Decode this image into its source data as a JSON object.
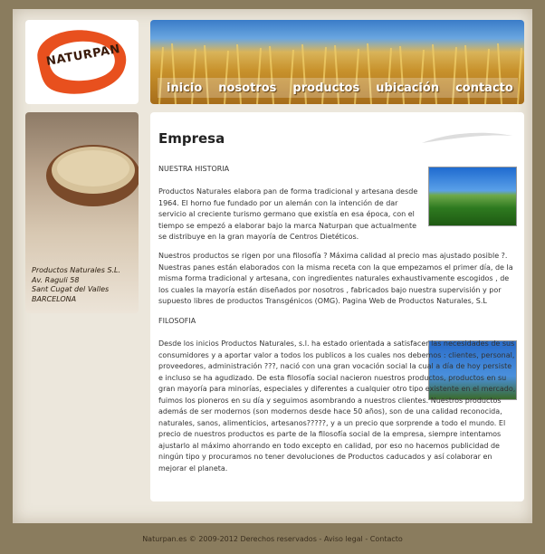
{
  "logo": {
    "text": "NATURPAN"
  },
  "nav": {
    "items": [
      "inicio",
      "nosotros",
      "productos",
      "ubicación",
      "contacto"
    ]
  },
  "sidebar": {
    "address": [
      "Productos Naturales S.L.",
      "Av. Raguli 58",
      "Sant Cugat del Valles",
      "BARCELONA"
    ]
  },
  "content": {
    "title": "Empresa",
    "section1_title": "NUESTRA HISTORIA",
    "section1_p1": "Productos Naturales elabora pan de forma tradicional y artesana desde 1964. El horno fue fundado por un alemán con la intención de dar servicio al creciente turismo germano que existía en esa época, con el tiempo se empezó a elaborar bajo la marca Naturpan que actualmente se distribuye en la gran mayoría de Centros Dietéticos.",
    "section1_p2": "Nuestros productos se rigen por una filosofía ? Máxima calidad al precio mas ajustado posible ?. Nuestras panes están elaborados con la misma receta con la que empezamos el primer día, de la misma forma tradicional y artesana, con ingredientes naturales exhaustivamente escogidos , de los cuales la mayoría están diseñados por nosotros , fabricados bajo nuestra supervisión y por supuesto libres de productos Transgénicos (OMG). Pagina Web de Productos Naturales, S.L",
    "section2_title": "FILOSOFIA",
    "section2_p1": "Desde los inicios Productos Naturales, s.l. ha estado orientada a satisfacer las necesidades de sus consumidores y a aportar valor a todos los publicos a los cuales nos debemos : clientes, personal, proveedores, administración ???, nació con una gran vocación social la cual a día de hoy persiste e incluso se ha agudizado. De esta filosofía social nacieron nuestros productos, productos en su gran mayoría para minorías, especiales y diferentes a cualquier otro tipo existente en el mercado, fuimos los pioneros en su día y seguimos asombrando a nuestros clientes. Nuestros productos además de ser modernos (son modernos desde hace 50 años), son de una calidad reconocida, naturales, sanos, alimenticios, artesanos?????, y a un precio que sorprende a todo el mundo. El precio de nuestros productos es parte de la filosofía social de la empresa, siempre intentamos ajustarlo al máximo ahorrando en todo excepto en calidad, por eso no hacemos publicidad de ningún tipo y procuramos no tener devoluciones de Productos caducados y así colaborar en mejorar el planeta."
  },
  "footer": {
    "copyright": "Naturpan.es © 2009-2012 Derechos reservados",
    "sep1": " - ",
    "legal": "Aviso legal",
    "sep2": " - ",
    "contact": "Contacto"
  },
  "colors": {
    "logo_orange": "#e8501e",
    "background": "#8a7c5e"
  }
}
